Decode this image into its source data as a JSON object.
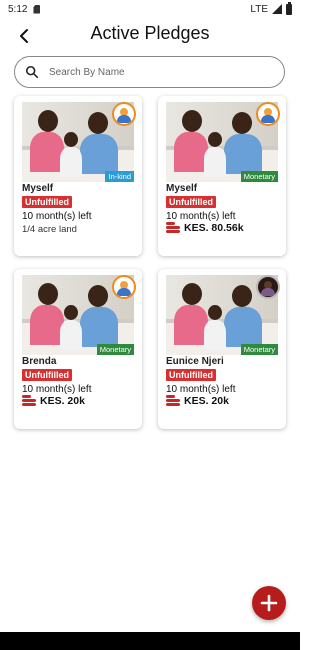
{
  "status_bar": {
    "time": "5:12",
    "network": "LTE"
  },
  "header": {
    "title": "Active Pledges"
  },
  "search": {
    "placeholder": "Search By Name"
  },
  "pledges": [
    {
      "owner": "Myself",
      "type": "In-kind",
      "status": "Unfulfilled",
      "time_left": "10 month(s) left",
      "detail": "1/4 acre land"
    },
    {
      "owner": "Myself",
      "type": "Monetary",
      "status": "Unfulfilled",
      "time_left": "10 month(s) left",
      "amount": "KES. 80.56k"
    },
    {
      "owner": "Brenda",
      "type": "Monetary",
      "status": "Unfulfilled",
      "time_left": "10 month(s) left",
      "amount": "KES. 20k"
    },
    {
      "owner": "Eunice Njeri",
      "type": "Monetary",
      "status": "Unfulfilled",
      "time_left": "10 month(s) left",
      "amount": "KES. 20k"
    }
  ],
  "colors": {
    "accent": "#b71c1c",
    "unfulfilled": "#d63030",
    "inkind": "#2b9bd4",
    "monetary": "#2e8b3d"
  },
  "icons": {
    "back": "arrow-left-icon",
    "search": "search-icon",
    "add": "plus-icon",
    "amount": "coins-icon"
  }
}
